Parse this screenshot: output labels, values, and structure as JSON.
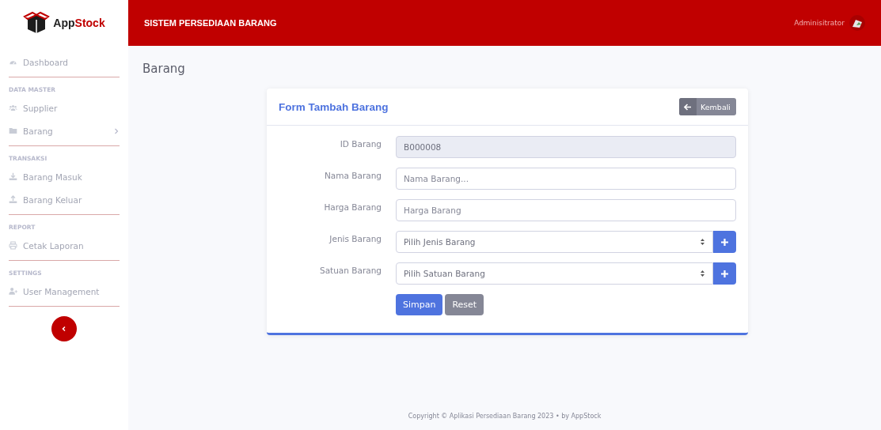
{
  "sidebar": {
    "brand": {
      "name_1": "App",
      "name_2": "Stock"
    },
    "sections": [
      {
        "items": [
          {
            "label": "Dashboard"
          }
        ]
      },
      {
        "heading": "DATA MASTER",
        "items": [
          {
            "label": "Supplier"
          },
          {
            "label": "Barang",
            "expanded": false
          }
        ]
      },
      {
        "heading": "TRANSAKSI",
        "items": [
          {
            "label": "Barang Masuk"
          },
          {
            "label": "Barang Keluar"
          }
        ]
      },
      {
        "heading": "REPORT",
        "items": [
          {
            "label": "Cetak Laporan"
          }
        ]
      },
      {
        "heading": "SETTINGS",
        "items": [
          {
            "label": "User Management"
          }
        ]
      }
    ]
  },
  "topbar": {
    "title": "SISTEM PERSEDIAAN BARANG",
    "user": "Adminisitrator"
  },
  "page_title": "Barang",
  "form": {
    "title": "Form Tambah Barang",
    "back_button": "Kembali",
    "fields": [
      {
        "kind": "readonly",
        "label": "ID Barang",
        "value": "B000008"
      },
      {
        "kind": "input",
        "label": "Nama Barang",
        "placeholder": "Nama Barang..."
      },
      {
        "kind": "input",
        "label": "Harga Barang",
        "placeholder": "Harga Barang"
      },
      {
        "kind": "select",
        "label": "Jenis Barang",
        "value": "Pilih Jenis Barang"
      },
      {
        "kind": "select",
        "label": "Satuan Barang",
        "value": "Pilih Satuan Barang"
      }
    ],
    "buttons": [
      {
        "kind": "primary",
        "label": "Simpan"
      },
      {
        "kind": "secondary",
        "label": "Reset"
      }
    ]
  },
  "footer": "Copyright © Aplikasi Persediaan Barang 2023 • by AppStock"
}
